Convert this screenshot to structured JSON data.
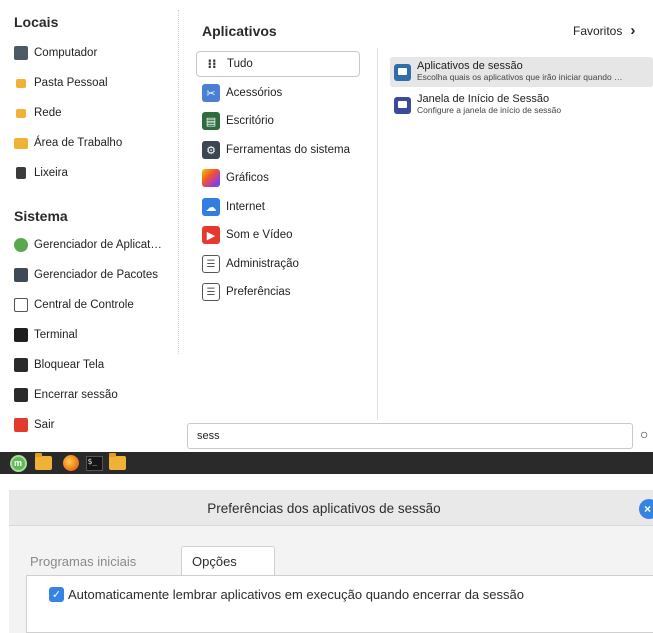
{
  "menu": {
    "places_title": "Locais",
    "places": [
      {
        "label": "Computador",
        "icon": "computer-icon"
      },
      {
        "label": "Pasta Pessoal",
        "icon": "home-folder-icon"
      },
      {
        "label": "Rede",
        "icon": "network-folder-icon"
      },
      {
        "label": "Área de Trabalho",
        "icon": "desktop-folder-icon"
      },
      {
        "label": "Lixeira",
        "icon": "trash-icon"
      }
    ],
    "system_title": "Sistema",
    "system": [
      {
        "label": "Gerenciador de Aplicat…",
        "icon": "software-manager-icon"
      },
      {
        "label": "Gerenciador de Pacotes",
        "icon": "package-manager-icon"
      },
      {
        "label": "Central de Controle",
        "icon": "control-center-icon"
      },
      {
        "label": "Terminal",
        "icon": "terminal-icon"
      },
      {
        "label": "Bloquear Tela",
        "icon": "lock-icon"
      },
      {
        "label": "Encerrar sessão",
        "icon": "logout-icon"
      },
      {
        "label": "Sair",
        "icon": "power-icon"
      }
    ],
    "categories_title": "Aplicativos",
    "favorites_label": "Favoritos",
    "categories": [
      {
        "label": "Tudo",
        "icon": "grid-icon"
      },
      {
        "label": "Acessórios",
        "icon": "accessories-icon"
      },
      {
        "label": "Escritório",
        "icon": "office-icon"
      },
      {
        "label": "Ferramentas do sistema",
        "icon": "system-tools-icon"
      },
      {
        "label": "Gráficos",
        "icon": "graphics-icon"
      },
      {
        "label": "Internet",
        "icon": "internet-icon"
      },
      {
        "label": "Som e Vídeo",
        "icon": "multimedia-icon"
      },
      {
        "label": "Administração",
        "icon": "administration-icon"
      },
      {
        "label": "Preferências",
        "icon": "preferences-icon"
      }
    ],
    "apps": [
      {
        "name": "Aplicativos de sessão",
        "desc": "Escolha quais os aplicativos que irão iniciar quando …",
        "icon": "session-apps-icon"
      },
      {
        "name": "Janela de Início de Sessão",
        "desc": "Configure a janela de início de sessão",
        "icon": "login-window-icon"
      }
    ],
    "search_value": "sess",
    "colors": {
      "accent": "#3584e4",
      "mint_green": "#63b95a"
    }
  },
  "taskbar": {
    "items": [
      "mint-menu-icon",
      "files-icon",
      "firefox-icon",
      "terminal-icon",
      "folder-icon"
    ]
  },
  "dialog": {
    "title": "Preferências dos aplicativos de sessão",
    "tabs": [
      "Programas iniciais",
      "Opções"
    ],
    "active_tab": "Opções",
    "option_label": "Automaticamente lembrar aplicativos em execução quando encerrar da sessão",
    "option_checked": true
  }
}
